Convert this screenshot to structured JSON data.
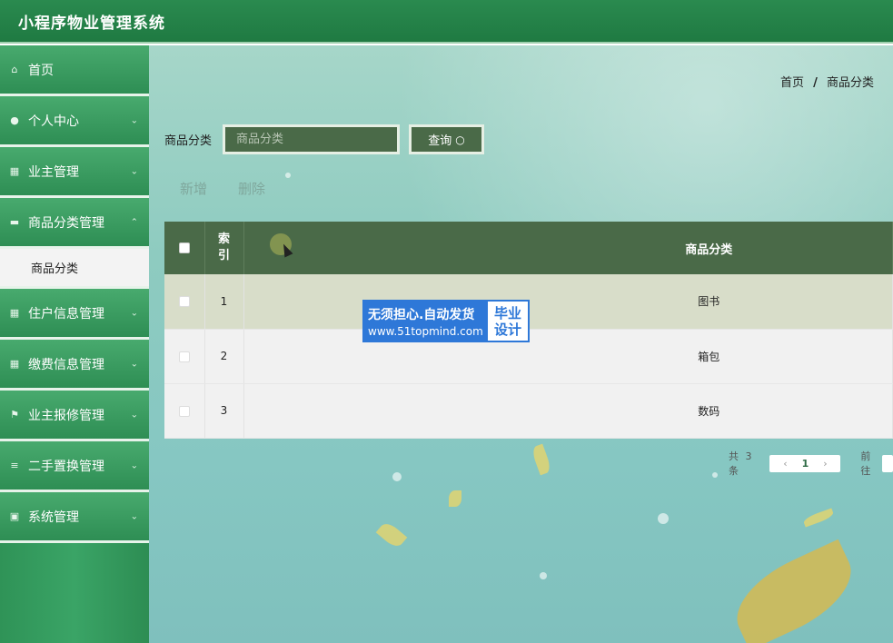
{
  "app": {
    "title": "小程序物业管理系统"
  },
  "sidebar": {
    "items": [
      {
        "label": "首页",
        "icon": "home-icon",
        "has_arrow": false
      },
      {
        "label": "个人中心",
        "icon": "user-icon",
        "has_arrow": true
      },
      {
        "label": "业主管理",
        "icon": "grid-icon",
        "has_arrow": true
      },
      {
        "label": "商品分类管理",
        "icon": "box-icon",
        "has_arrow": true,
        "expanded": true,
        "children": [
          {
            "label": "商品分类",
            "active": true
          }
        ]
      },
      {
        "label": "住户信息管理",
        "icon": "grid-icon",
        "has_arrow": true
      },
      {
        "label": "缴费信息管理",
        "icon": "grid-icon",
        "has_arrow": true
      },
      {
        "label": "业主报修管理",
        "icon": "flag-icon",
        "has_arrow": true
      },
      {
        "label": "二手置换管理",
        "icon": "list-icon",
        "has_arrow": true
      },
      {
        "label": "系统管理",
        "icon": "settings-icon",
        "has_arrow": true
      }
    ]
  },
  "breadcrumb": {
    "home": "首页",
    "separator": "/",
    "current": "商品分类"
  },
  "search": {
    "label": "商品分类",
    "placeholder": "商品分类",
    "value": "",
    "button_label": "查询"
  },
  "actions": {
    "add_label": "新增",
    "delete_label": "删除"
  },
  "table": {
    "columns": {
      "index": "索\n引",
      "category": "商品分类"
    },
    "rows": [
      {
        "index": "1",
        "category": "图书"
      },
      {
        "index": "2",
        "category": "箱包"
      },
      {
        "index": "3",
        "category": "数码"
      }
    ]
  },
  "pagination": {
    "total_prefix": "共",
    "total": "3",
    "total_suffix": "条",
    "current_page": "1",
    "goto_label": "前往"
  },
  "watermark": {
    "line1": "无须担心.自动发货",
    "line2": "www.51topmind.com",
    "right1": "毕业",
    "right2": "设计"
  },
  "colors": {
    "header": "#1f7a42",
    "table_header": "#4a6a48",
    "highlight_row": "#d8ddc9"
  }
}
